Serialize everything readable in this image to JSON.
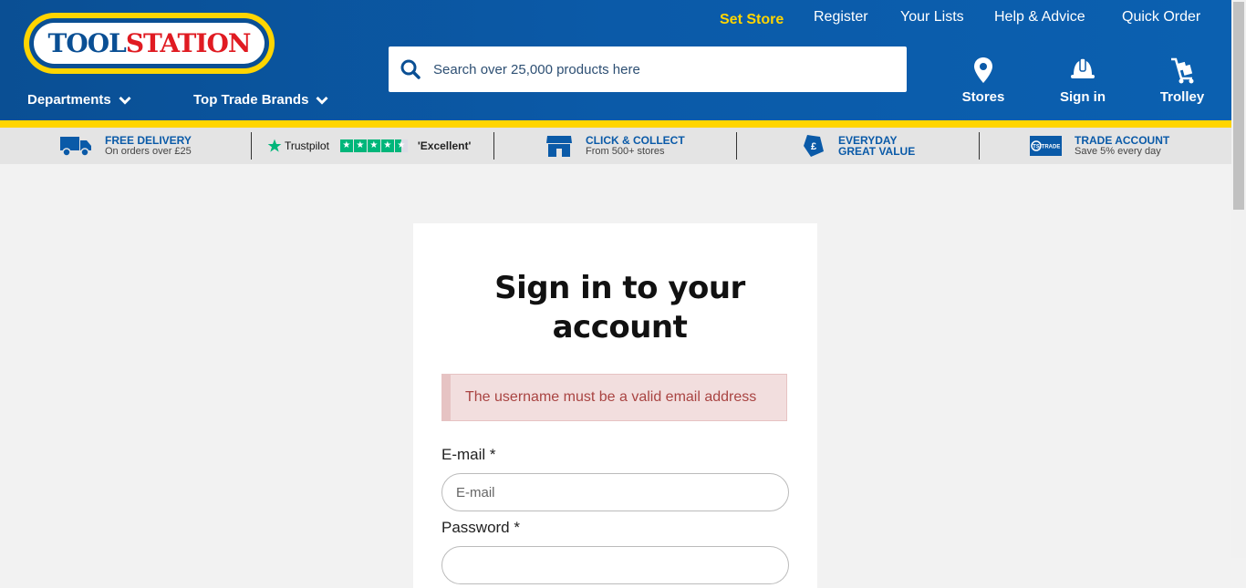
{
  "brand": {
    "logo_part1": "TOOL",
    "logo_part2": "STATION"
  },
  "colors": {
    "header_blue": "#0b5aa8",
    "accent_yellow": "#ffd500",
    "logo_red": "#e01b22",
    "error_text": "#a94442",
    "error_bg": "#f2dede"
  },
  "topnav": {
    "set_store": "Set Store",
    "register": "Register",
    "your_lists": "Your Lists",
    "help_advice": "Help & Advice",
    "quick_order": "Quick Order"
  },
  "search": {
    "placeholder": "Search over 25,000 products here",
    "icon": "search-icon"
  },
  "menu": {
    "departments": "Departments",
    "top_trade_brands": "Top Trade Brands"
  },
  "icon_nav": {
    "stores": "Stores",
    "sign_in": "Sign in",
    "trolley": "Trolley"
  },
  "usp": {
    "delivery": {
      "title": "FREE DELIVERY",
      "sub": "On orders over £25",
      "icon": "truck-icon"
    },
    "trustpilot": {
      "brand": "Trustpilot",
      "rating_text": "'Excellent'",
      "stars": 4.5
    },
    "collect": {
      "title": "CLICK & COLLECT",
      "sub": "From 500+ stores",
      "icon": "storefront-icon"
    },
    "value": {
      "title_line1": "EVERYDAY",
      "title_line2": "GREAT VALUE",
      "icon": "price-tag-icon"
    },
    "trade": {
      "title": "TRADE ACCOUNT",
      "sub": "Save 5% every day",
      "badge_text": "TS TRADE"
    }
  },
  "signin": {
    "heading_line1": "Sign in to your",
    "heading_line2": "account",
    "error": "The username must be a valid email address",
    "email_label": "E-mail *",
    "email_placeholder": "E-mail",
    "password_label": "Password *"
  }
}
